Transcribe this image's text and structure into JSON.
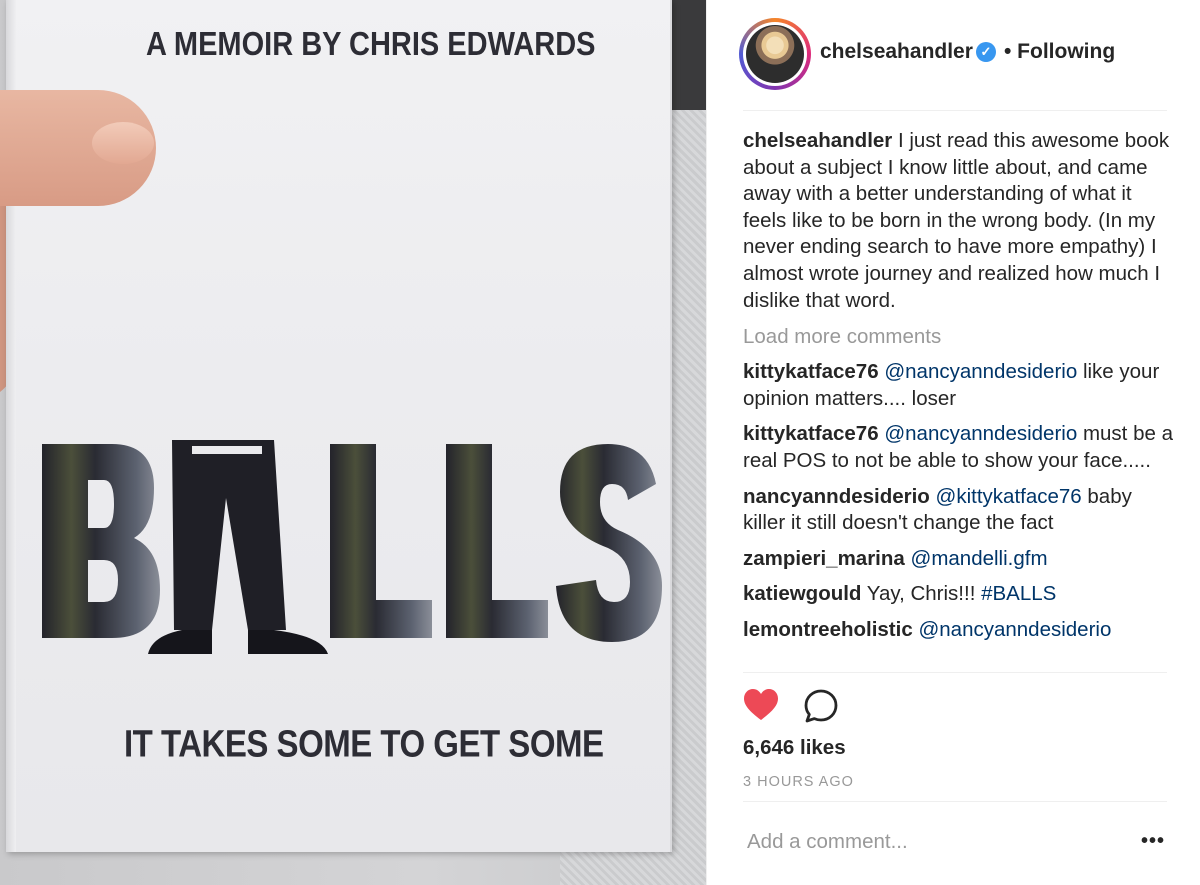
{
  "photo": {
    "memoir_line": "A MEMOIR BY CHRIS EDWARDS",
    "title": "BALLS",
    "tagline": "IT TAKES SOME TO GET SOME"
  },
  "header": {
    "username": "chelseahandler",
    "verified_glyph": "✓",
    "follow_status": "• Following"
  },
  "caption": {
    "username": "chelseahandler",
    "text": "I just read this awesome book about a subject I know little about, and came away with a better understanding of what it feels like to be born in the wrong body. (In my never ending search to have more empathy) I almost wrote journey and realized how much I dislike that word."
  },
  "load_more": "Load more comments",
  "comments": [
    {
      "user": "kittykatface76",
      "mention": "@nancyanndesiderio",
      "text": "like your opinion matters.... loser"
    },
    {
      "user": "kittykatface76",
      "mention": "@nancyanndesiderio",
      "text": "must be a real POS to not be able to show your face....."
    },
    {
      "user": "nancyanndesiderio",
      "mention": "@kittykatface76",
      "text": "baby killer it still doesn't change the fact"
    },
    {
      "user": "zampieri_marina",
      "mention": "@mandelli.gfm",
      "text": ""
    },
    {
      "user": "katiewgould",
      "mention": "",
      "text": "Yay, Chris!!!",
      "hashtag": "#BALLS"
    },
    {
      "user": "lemontreeholistic",
      "mention": "@nancyanndesiderio",
      "text": ""
    }
  ],
  "actions": {
    "heart_icon": "heart-icon",
    "comment_icon": "comment-bubble-icon",
    "heart_color": "#ed4956"
  },
  "likes": "6,646 likes",
  "timestamp": "3 HOURS AGO",
  "add_comment": {
    "placeholder": "Add a comment...",
    "more_label": "•••"
  },
  "colors": {
    "mention": "#003569",
    "muted": "#999999",
    "text": "#262626",
    "verified": "#3897f0"
  }
}
